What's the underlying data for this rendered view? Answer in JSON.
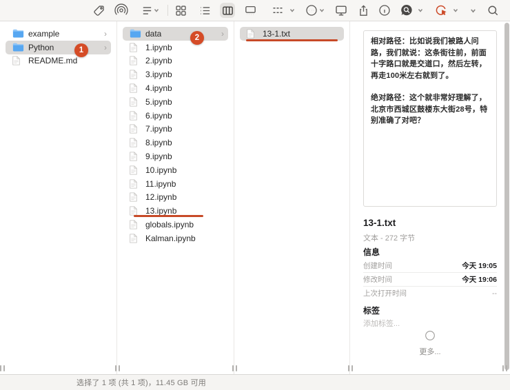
{
  "toolbar": {
    "active_view": "column-view",
    "icons": [
      "tags",
      "airdrop",
      "group-by",
      "icon-view",
      "list-view",
      "column-view",
      "gallery-view",
      "grouping",
      "more-actions",
      "share-screen",
      "share",
      "get-info",
      "search-app",
      "annotate-app",
      "overflow",
      "search"
    ]
  },
  "columns": [
    {
      "name": "column-1",
      "items": [
        {
          "label": "example",
          "type": "folder",
          "selected": false,
          "chevron": true
        },
        {
          "label": "Python",
          "type": "folder",
          "selected": true,
          "chevron": true
        },
        {
          "label": "README.md",
          "type": "document",
          "selected": false,
          "chevron": false
        }
      ]
    },
    {
      "name": "column-2",
      "items": [
        {
          "label": "data",
          "type": "folder",
          "selected": true,
          "chevron": true
        },
        {
          "label": "1.ipynb",
          "type": "document"
        },
        {
          "label": "2.ipynb",
          "type": "document"
        },
        {
          "label": "3.ipynb",
          "type": "document"
        },
        {
          "label": "4.ipynb",
          "type": "document"
        },
        {
          "label": "5.ipynb",
          "type": "document"
        },
        {
          "label": "6.ipynb",
          "type": "document"
        },
        {
          "label": "7.ipynb",
          "type": "document"
        },
        {
          "label": "8.ipynb",
          "type": "document"
        },
        {
          "label": "9.ipynb",
          "type": "document"
        },
        {
          "label": "10.ipynb",
          "type": "document"
        },
        {
          "label": "11.ipynb",
          "type": "document"
        },
        {
          "label": "12.ipynb",
          "type": "document"
        },
        {
          "label": "13.ipynb",
          "type": "document"
        },
        {
          "label": "globals.ipynb",
          "type": "document"
        },
        {
          "label": "Kalman.ipynb",
          "type": "document"
        }
      ]
    },
    {
      "name": "column-3",
      "items": [
        {
          "label": "13-1.txt",
          "type": "document",
          "selected": true,
          "chevron": false
        }
      ]
    }
  ],
  "preview": {
    "document_text": [
      "相对路径：比如说我们被路人问路，我们就说：这条街往前，前面十字路口就是交道口，然后左转，再走100米左右就到了。",
      "绝对路径：这个就非常好理解了，北京市西城区鼓楼东大街28号，特别准确了对吧？"
    ],
    "file_name": "13-1.txt",
    "file_kind": "文本 - 272 字节",
    "sections": {
      "info_title": "信息",
      "rows": [
        {
          "label": "创建时间",
          "value": "今天 19:05"
        },
        {
          "label": "修改时间",
          "value": "今天 19:06"
        },
        {
          "label": "上次打开时间",
          "value": "--"
        }
      ],
      "tags_title": "标签",
      "tags_placeholder": "添加标签...",
      "more_label": "更多..."
    }
  },
  "status_bar": {
    "text": "选择了 1 项 (共 1 项)，11.45 GB 可用"
  },
  "annotations": {
    "badge_1": "1",
    "badge_2": "2",
    "color": "#d54c27"
  }
}
